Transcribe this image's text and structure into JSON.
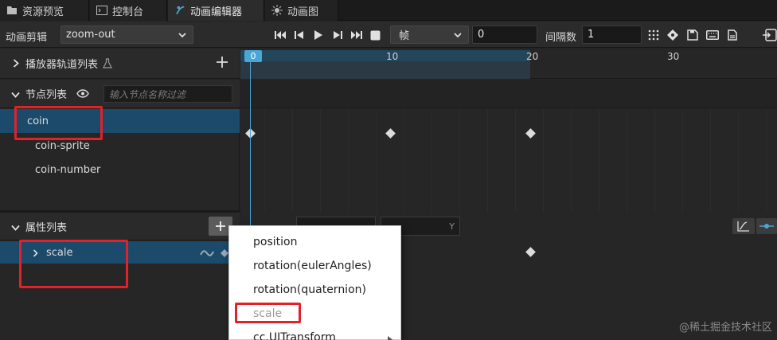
{
  "tabs": [
    {
      "label": "资源预览",
      "icon": "folder-icon"
    },
    {
      "label": "控制台",
      "icon": "terminal-icon"
    },
    {
      "label": "动画编辑器",
      "icon": "animation-editor-icon",
      "active": true
    },
    {
      "label": "动画图",
      "icon": "animation-graph-icon"
    }
  ],
  "toolbar": {
    "clip_label": "动画剪辑",
    "clip_value": "zoom-out",
    "unit_value": "帧",
    "frame_value": "0",
    "interval_label": "间隔数",
    "interval_value": "1"
  },
  "panels": {
    "player_tracks": "播放器轨道列表",
    "node_list": "节点列表",
    "node_filter_placeholder": "输入节点名称过滤",
    "property_list": "属性列表"
  },
  "nodes": [
    "coin",
    "coin-sprite",
    "coin-number"
  ],
  "properties": [
    "scale"
  ],
  "timeline": {
    "ticks": [
      "0",
      "10",
      "20",
      "30"
    ]
  },
  "context_menu": {
    "items": [
      "position",
      "rotation(eulerAngles)",
      "rotation(quaternion)",
      "scale",
      "cc.UITransform"
    ]
  },
  "property_bar": {
    "field_y_hint": "Y"
  },
  "colors": {
    "accent": "#4aa6d6",
    "selection": "#1b4a6a",
    "highlight_box": "#e0222b"
  },
  "watermark": "@稀土掘金技术社区"
}
